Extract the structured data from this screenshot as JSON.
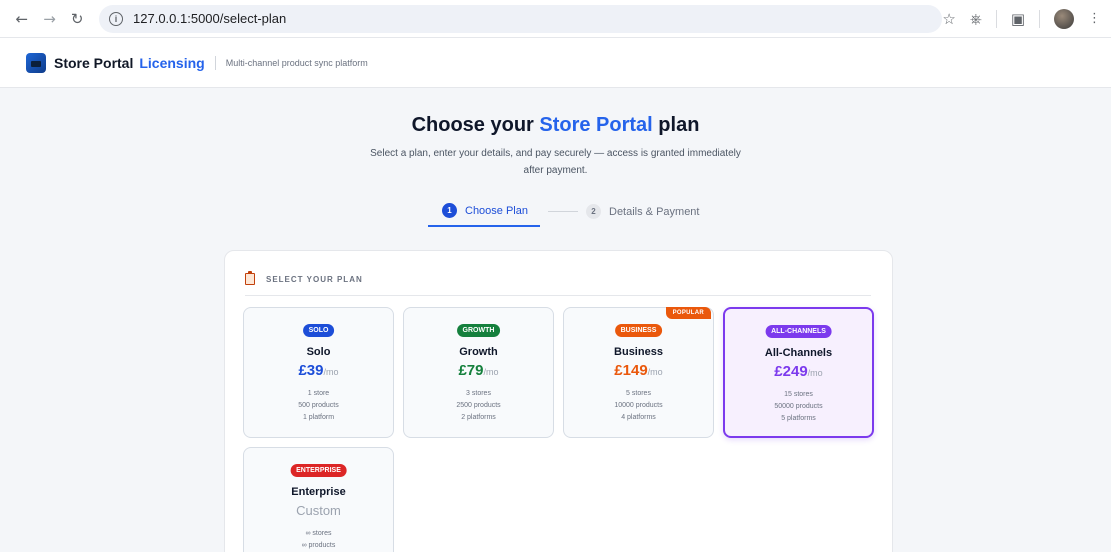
{
  "browser": {
    "url": "127.0.0.1:5000/select-plan",
    "icons": [
      "back-icon",
      "forward-icon",
      "reload-icon",
      "site-info-icon",
      "star-icon",
      "extensions-icon",
      "lens-icon",
      "profile-avatar",
      "menu-icon"
    ]
  },
  "header": {
    "brand": "Store Portal",
    "brand_accent": "Licensing",
    "tagline": "Multi-channel product sync platform"
  },
  "hero": {
    "title_prefix": "Choose your ",
    "title_accent": "Store Portal",
    "title_suffix": " plan",
    "subtitle": "Select a plan, enter your details, and pay securely — access is granted immediately after payment."
  },
  "stepper": {
    "steps": [
      {
        "num": "1",
        "label": "Choose Plan",
        "active": true
      },
      {
        "num": "2",
        "label": "Details & Payment",
        "active": false
      }
    ]
  },
  "plan_section": {
    "title": "SELECT YOUR PLAN",
    "plans": [
      {
        "badge": "SOLO",
        "badge_color": "#1d4ed8",
        "name": "Solo",
        "price": "£39",
        "unit": "/mo",
        "price_color": "#1d4ed8",
        "f1": "1 store",
        "f2": "500 products",
        "f3": "1 platform"
      },
      {
        "badge": "GROWTH",
        "badge_color": "#15803d",
        "name": "Growth",
        "price": "£79",
        "unit": "/mo",
        "price_color": "#15803d",
        "f1": "3 stores",
        "f2": "2500 products",
        "f3": "2 platforms"
      },
      {
        "badge": "BUSINESS",
        "badge_color": "#ea580c",
        "name": "Business",
        "price": "£149",
        "unit": "/mo",
        "price_color": "#ea580c",
        "f1": "5 stores",
        "f2": "10000 products",
        "f3": "4 platforms",
        "ribbon": "POPULAR"
      },
      {
        "badge": "ALL-CHANNELS",
        "badge_color": "#7c3aed",
        "name": "All-Channels",
        "price": "£249",
        "unit": "/mo",
        "price_color": "#7c3aed",
        "f1": "15 stores",
        "f2": "50000 products",
        "f3": "5 platforms",
        "selected": true
      },
      {
        "badge": "ENTERPRISE",
        "badge_color": "#dc2626",
        "name": "Enterprise",
        "price": "Custom",
        "f1": "∞ stores",
        "f2": "∞ products"
      }
    ]
  }
}
